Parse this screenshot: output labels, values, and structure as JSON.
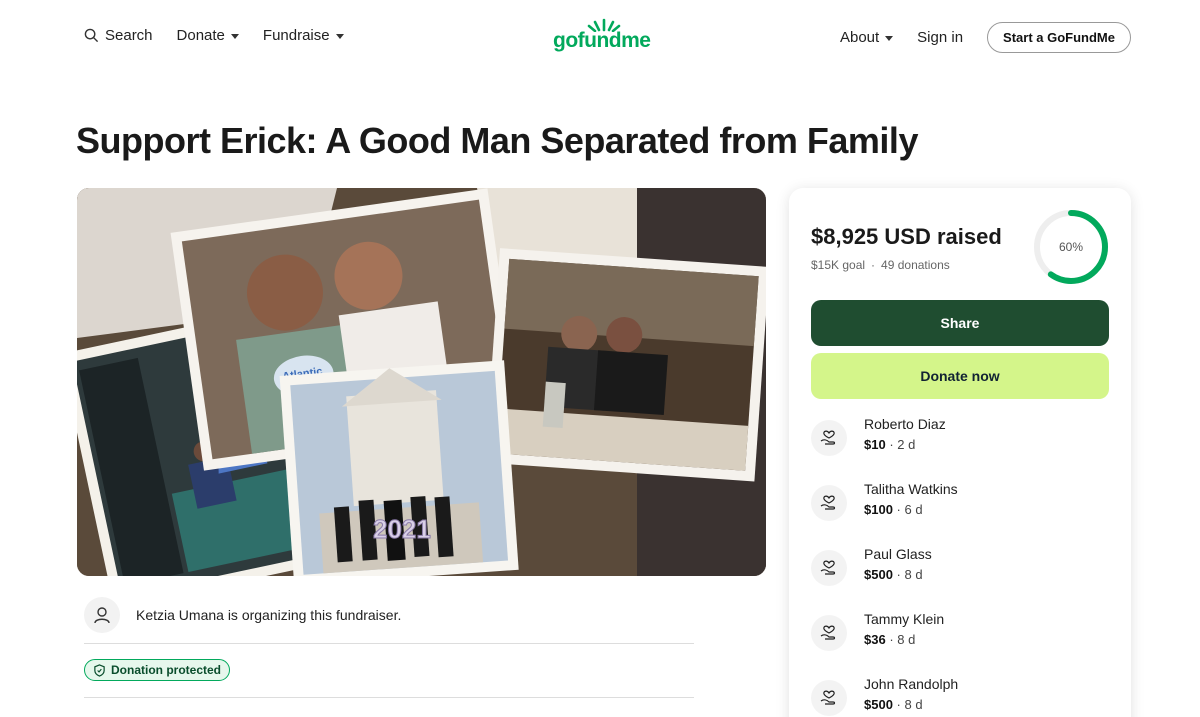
{
  "header": {
    "search_label": "Search",
    "donate_label": "Donate",
    "fundraise_label": "Fundraise",
    "logo_text": "gofundme",
    "about_label": "About",
    "signin_label": "Sign in",
    "start_label": "Start a GoFundMe"
  },
  "page": {
    "title": "Support Erick: A Good Man Separated from Family"
  },
  "organizer": {
    "text": "Ketzia Umana is organizing this fundraiser."
  },
  "protection": {
    "label": "Donation protected"
  },
  "panel": {
    "raised": "$8,925 USD raised",
    "goal": "$15K goal",
    "donations": "49 donations",
    "progress_label": "60%",
    "progress": 0.6,
    "share_label": "Share",
    "donate_label": "Donate now"
  },
  "donors": [
    {
      "name": "Roberto Diaz",
      "amount": "$10",
      "time": "2 d"
    },
    {
      "name": "Talitha Watkins",
      "amount": "$100",
      "time": "6 d"
    },
    {
      "name": "Paul Glass",
      "amount": "$500",
      "time": "8 d"
    },
    {
      "name": "Tammy Klein",
      "amount": "$36",
      "time": "8 d"
    },
    {
      "name": "John Randolph",
      "amount": "$500",
      "time": "8 d"
    }
  ],
  "photo": {
    "sign_text": "Atlantic",
    "year_text": "2021"
  },
  "colors": {
    "brand": "#02a95c",
    "share_bg": "#1f4d30",
    "donate_bg": "#d4f58a"
  }
}
